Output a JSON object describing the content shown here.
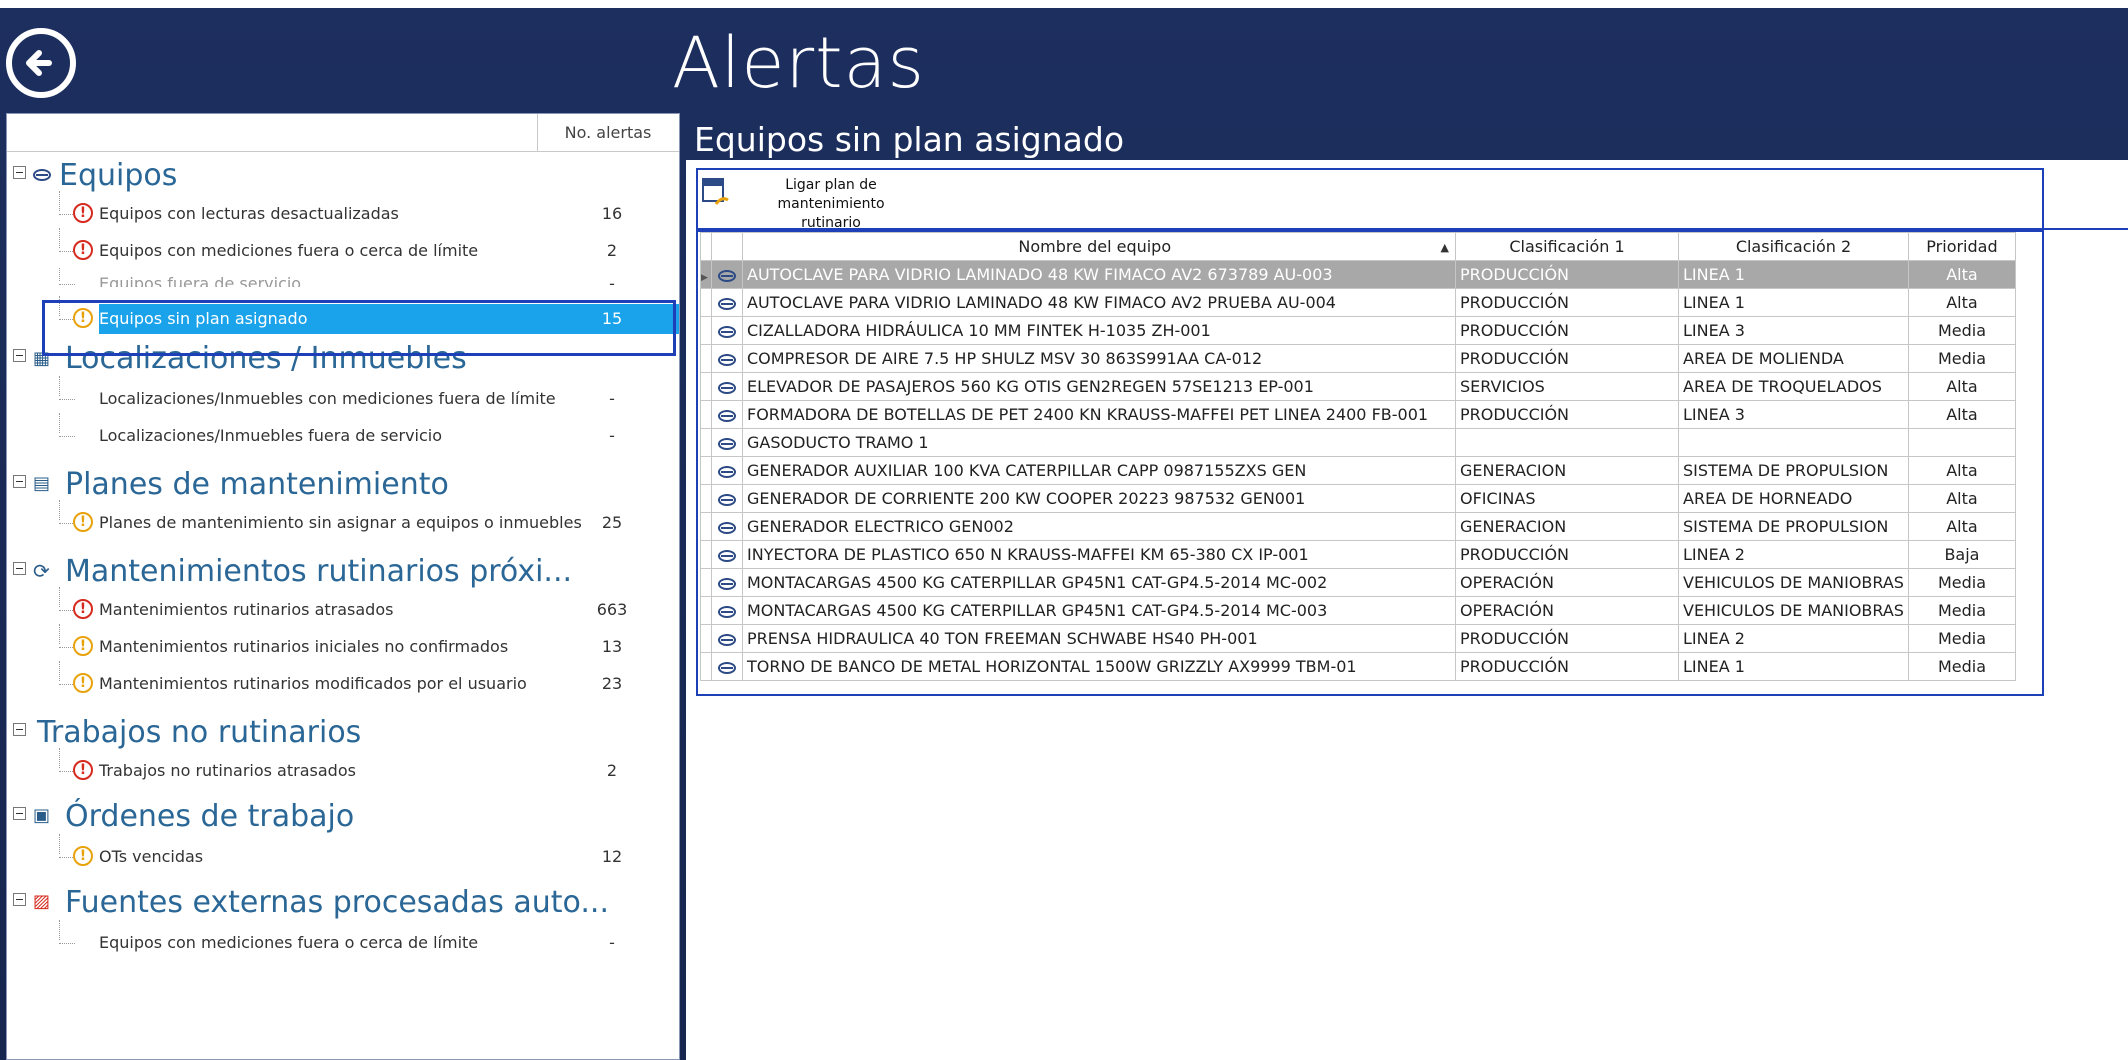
{
  "header": {
    "title": "Alertas"
  },
  "colors": {
    "background": "#1a2b57",
    "accent": "#1aa3ea",
    "outline": "#1d3fb8",
    "red": "#d62a1e",
    "yellow": "#e8a20c"
  },
  "tree": {
    "column_header": "No. alertas",
    "groups": [
      {
        "label": "Equipos",
        "icon": "equipment-icon",
        "items": [
          {
            "label": "Equipos con lecturas desactualizadas",
            "count": "16",
            "alert": "red"
          },
          {
            "label": "Equipos con mediciones fuera o cerca de límite",
            "count": "2",
            "alert": "red"
          },
          {
            "label": "Equipos fuera de servicio",
            "count": "-",
            "alert": "none"
          },
          {
            "label": "Equipos sin plan asignado",
            "count": "15",
            "alert": "yellow"
          }
        ]
      },
      {
        "label": "Localizaciones / Inmuebles",
        "icon": "location-icon",
        "items": [
          {
            "label": "Localizaciones/Inmuebles con mediciones fuera de límite",
            "count": "-",
            "alert": "none"
          },
          {
            "label": "Localizaciones/Inmuebles fuera de servicio",
            "count": "-",
            "alert": "none"
          }
        ]
      },
      {
        "label": "Planes de mantenimiento",
        "icon": "plan-icon",
        "items": [
          {
            "label": "Planes de mantenimiento sin asignar a equipos o inmuebles",
            "count": "25",
            "alert": "yellow"
          }
        ]
      },
      {
        "label": "Mantenimientos rutinarios próxi...",
        "icon": "routine-icon",
        "items": [
          {
            "label": "Mantenimientos rutinarios atrasados",
            "count": "663",
            "alert": "red"
          },
          {
            "label": "Mantenimientos rutinarios iniciales no confirmados",
            "count": "13",
            "alert": "yellow"
          },
          {
            "label": "Mantenimientos rutinarios modificados por el usuario",
            "count": "23",
            "alert": "yellow"
          }
        ]
      },
      {
        "label": "Trabajos no rutinarios",
        "icon": "",
        "items": [
          {
            "label": "Trabajos no rutinarios atrasados",
            "count": "2",
            "alert": "red"
          }
        ]
      },
      {
        "label": "Órdenes de trabajo",
        "icon": "work-order-icon",
        "items": [
          {
            "label": "OTs vencidas",
            "count": "12",
            "alert": "yellow"
          }
        ]
      },
      {
        "label": "Fuentes externas procesadas auto...",
        "icon": "pdf-icon",
        "items": [
          {
            "label": "Equipos con mediciones fuera o cerca de límite",
            "count": "-",
            "alert": "none"
          }
        ]
      }
    ]
  },
  "main": {
    "section_title": "Equipos sin plan asignado",
    "toolbar": {
      "link_plan_line1": "Ligar plan de mantenimiento",
      "link_plan_line2": "rutinario"
    },
    "table": {
      "headers": [
        "Nombre del equipo",
        "Clasificación 1",
        "Clasificación 2",
        "Prioridad"
      ],
      "rows": [
        [
          "AUTOCLAVE PARA VIDRIO LAMINADO 48 KW FIMACO AV2 673789 AU-003",
          "PRODUCCIÓN",
          "LINEA 1",
          "Alta"
        ],
        [
          "AUTOCLAVE PARA VIDRIO LAMINADO 48 KW FIMACO AV2 PRUEBA AU-004",
          "PRODUCCIÓN",
          "LINEA 1",
          "Alta"
        ],
        [
          "CIZALLADORA HIDRÁULICA 10 MM FINTEK H-1035 ZH-001",
          "PRODUCCIÓN",
          "LINEA 3",
          "Media"
        ],
        [
          "COMPRESOR DE AIRE 7.5 HP SHULZ MSV 30 863S991AA CA-012",
          "PRODUCCIÓN",
          "AREA DE MOLIENDA",
          "Media"
        ],
        [
          "ELEVADOR DE PASAJEROS 560 KG OTIS GEN2REGEN 57SE1213 EP-001",
          "SERVICIOS",
          "AREA DE TROQUELADOS",
          "Alta"
        ],
        [
          "FORMADORA DE BOTELLAS DE PET 2400 KN KRAUSS-MAFFEI PET LINEA 2400 FB-001",
          "PRODUCCIÓN",
          "LINEA 3",
          "Alta"
        ],
        [
          "GASODUCTO TRAMO 1",
          "",
          "",
          ""
        ],
        [
          "GENERADOR AUXILIAR 100 KVA CATERPILLAR CAPP 0987155ZXS GEN",
          "GENERACION",
          "SISTEMA DE PROPULSION",
          "Alta"
        ],
        [
          "GENERADOR DE CORRIENTE 200 KW COOPER 20223 987532 GEN001",
          "OFICINAS",
          "AREA DE HORNEADO",
          "Alta"
        ],
        [
          "GENERADOR ELECTRICO GEN002",
          "GENERACION",
          "SISTEMA DE PROPULSION",
          "Alta"
        ],
        [
          "INYECTORA DE PLASTICO 650 N KRAUSS-MAFFEI KM 65-380 CX IP-001",
          "PRODUCCIÓN",
          "LINEA 2",
          "Baja"
        ],
        [
          "MONTACARGAS 4500 KG CATERPILLAR GP45N1 CAT-GP4.5-2014 MC-002",
          "OPERACIÓN",
          "VEHICULOS DE MANIOBRAS",
          "Media"
        ],
        [
          "MONTACARGAS 4500 KG CATERPILLAR GP45N1 CAT-GP4.5-2014 MC-003",
          "OPERACIÓN",
          "VEHICULOS DE MANIOBRAS",
          "Media"
        ],
        [
          "PRENSA HIDRAULICA 40 TON FREEMAN SCHWABE HS40 PH-001",
          "PRODUCCIÓN",
          "LINEA 2",
          "Media"
        ],
        [
          "TORNO DE BANCO DE METAL HORIZONTAL 1500W GRIZZLY AX9999 TBM-01",
          "PRODUCCIÓN",
          "LINEA 1",
          "Media"
        ]
      ]
    }
  }
}
